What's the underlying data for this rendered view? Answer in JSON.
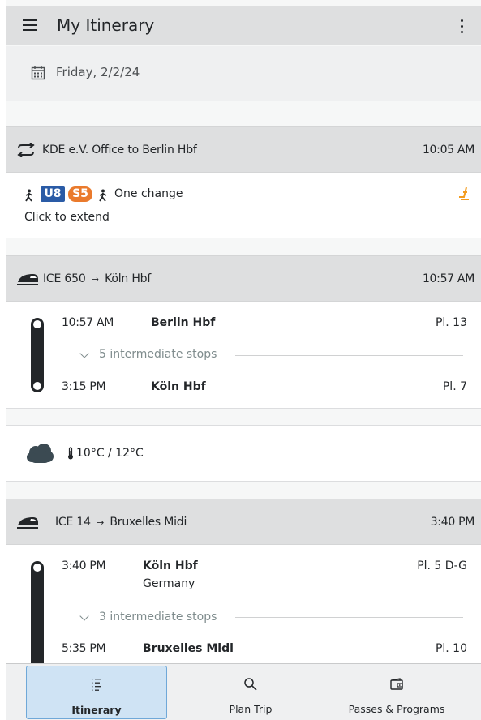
{
  "header": {
    "title": "My Itinerary"
  },
  "date": {
    "label": "Friday, 2/2/24"
  },
  "transfer": {
    "title": "KDE e.V. Office to Berlin Hbf",
    "time": "10:05 AM",
    "lines": [
      "U8",
      "S5"
    ],
    "summary": "One change",
    "hint": "Click to extend",
    "colors": {
      "u8": "#2a5ba6",
      "s5": "#ea7a2c",
      "accent": "#f39c1f"
    }
  },
  "trip1": {
    "title": "ICE 650",
    "arrow": "→",
    "destination": "Köln Hbf",
    "time": "10:57 AM",
    "departure": {
      "time": "10:57 AM",
      "station": "Berlin Hbf",
      "platform": "Pl. 13"
    },
    "stops": "5 intermediate stops",
    "arrival": {
      "time": "3:15 PM",
      "station": "Köln Hbf",
      "platform": "Pl. 7"
    }
  },
  "weather": {
    "temps": "10°C / 12°C"
  },
  "trip2": {
    "title": "ICE 14",
    "arrow": "→",
    "destination": "Bruxelles Midi",
    "time": "3:40 PM",
    "departure": {
      "time": "3:40 PM",
      "station": "Köln Hbf",
      "country": "Germany",
      "platform": "Pl. 5 D-G"
    },
    "stops": "3 intermediate stops",
    "arrival": {
      "time": "5:35 PM",
      "station": "Bruxelles Midi",
      "platform": "Pl. 10"
    }
  },
  "nav": {
    "items": [
      {
        "label": "Itinerary",
        "icon": "list-icon"
      },
      {
        "label": "Plan Trip",
        "icon": "search-icon"
      },
      {
        "label": "Passes & Programs",
        "icon": "wallet-icon"
      }
    ]
  }
}
